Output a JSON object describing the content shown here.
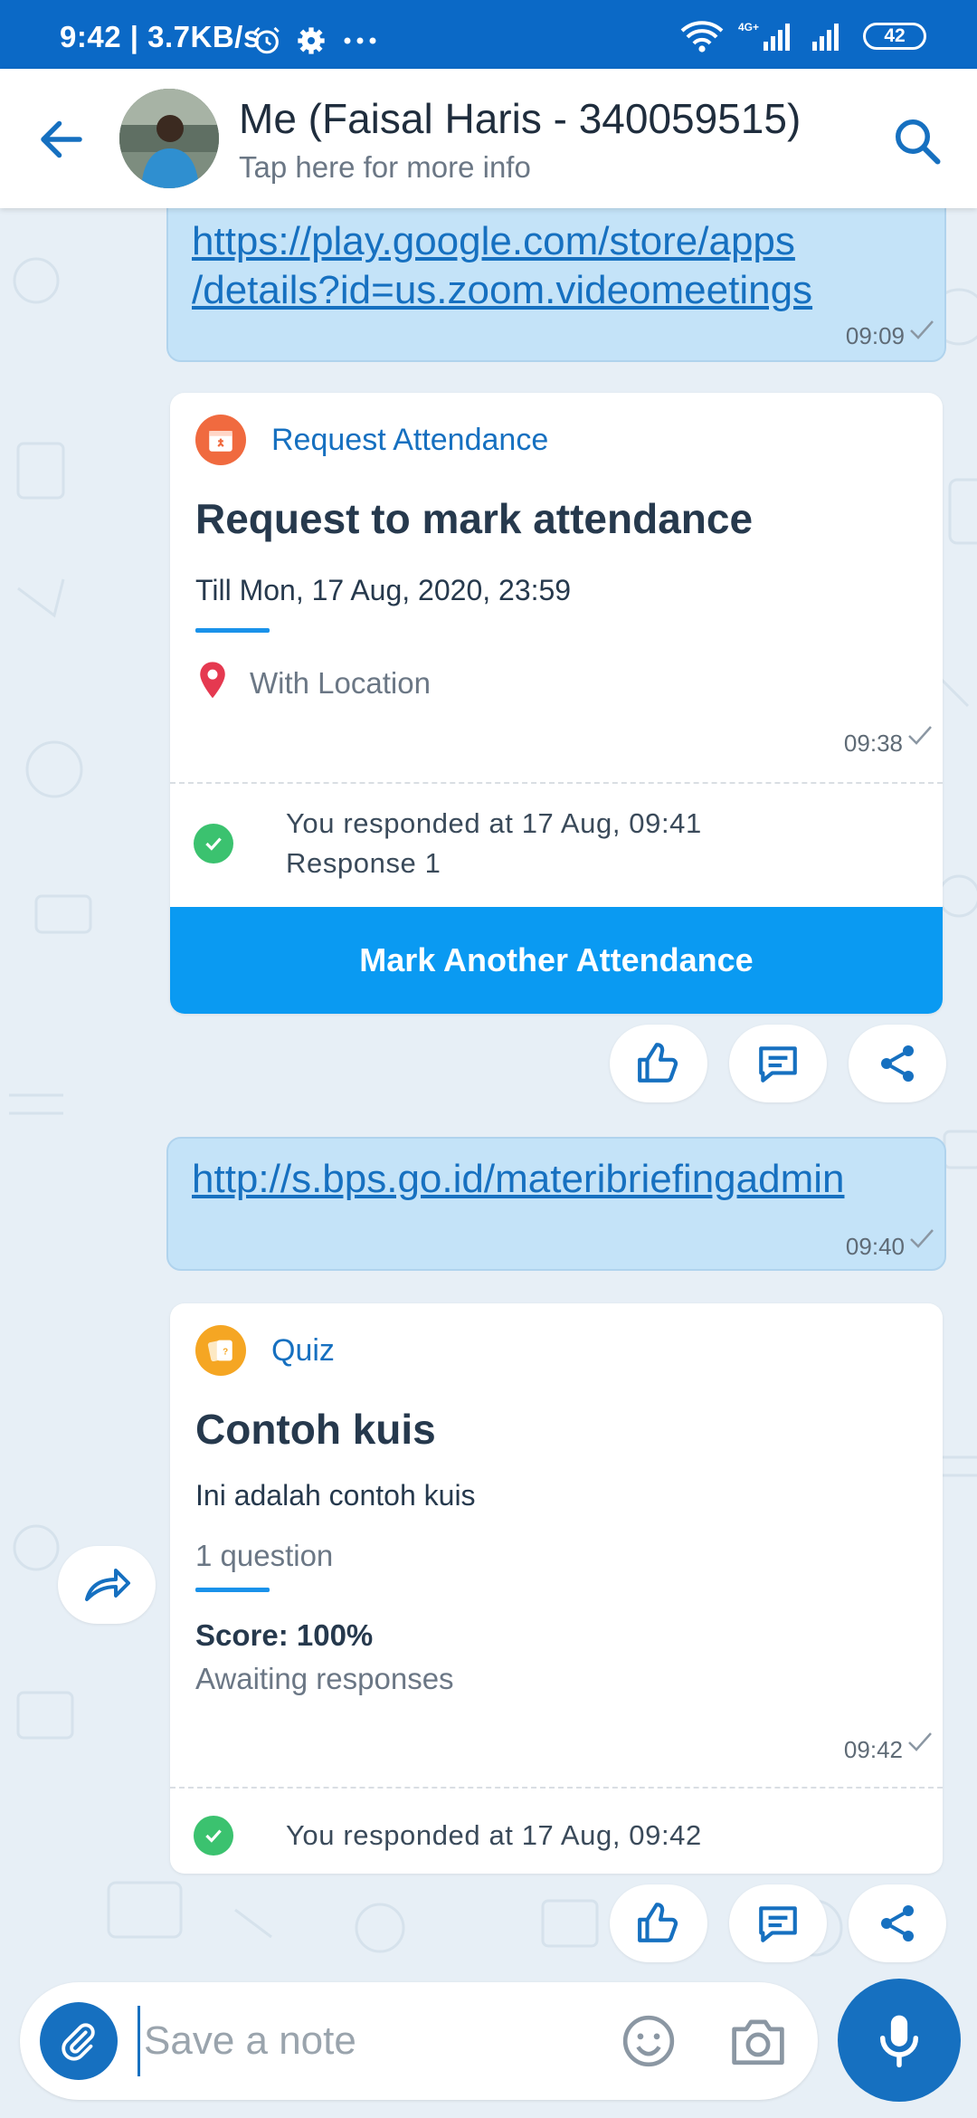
{
  "status_bar": {
    "time": "9:42",
    "speed": "3.7KB/s",
    "network": "4G+",
    "battery": "42",
    "color": "#0b69c6"
  },
  "header": {
    "title": "Me (Faisal Haris - 340059515)",
    "subtitle": "Tap here for more info"
  },
  "messages": {
    "zoom_link": {
      "line1": "https://play.google.com/store/apps",
      "line2": "/details?id=us.zoom.videomeetings",
      "time": "09:09"
    },
    "attendance": {
      "app": "Request Attendance",
      "title": "Request to mark attendance",
      "deadline": "Till Mon, 17 Aug, 2020, 23:59",
      "location": "With Location",
      "time": "09:38",
      "responded": "You responded at 17 Aug, 09:41",
      "response": "Response 1",
      "cta": "Mark Another Attendance"
    },
    "bps_link": {
      "text": "http://s.bps.go.id/materibriefingadmin",
      "time": "09:40"
    },
    "quiz": {
      "app": "Quiz",
      "title": "Contoh kuis",
      "description": "Ini adalah contoh kuis",
      "questions": "1 question",
      "score": "Score: 100%",
      "status": "Awaiting responses",
      "time": "09:42",
      "responded": "You responded at 17 Aug, 09:42"
    }
  },
  "composer": {
    "placeholder": "Save a note"
  },
  "colors": {
    "accent": "#1670c0",
    "cta": "#0a9af2",
    "bubble": "#c4e3f8",
    "success": "#3bc26f"
  }
}
